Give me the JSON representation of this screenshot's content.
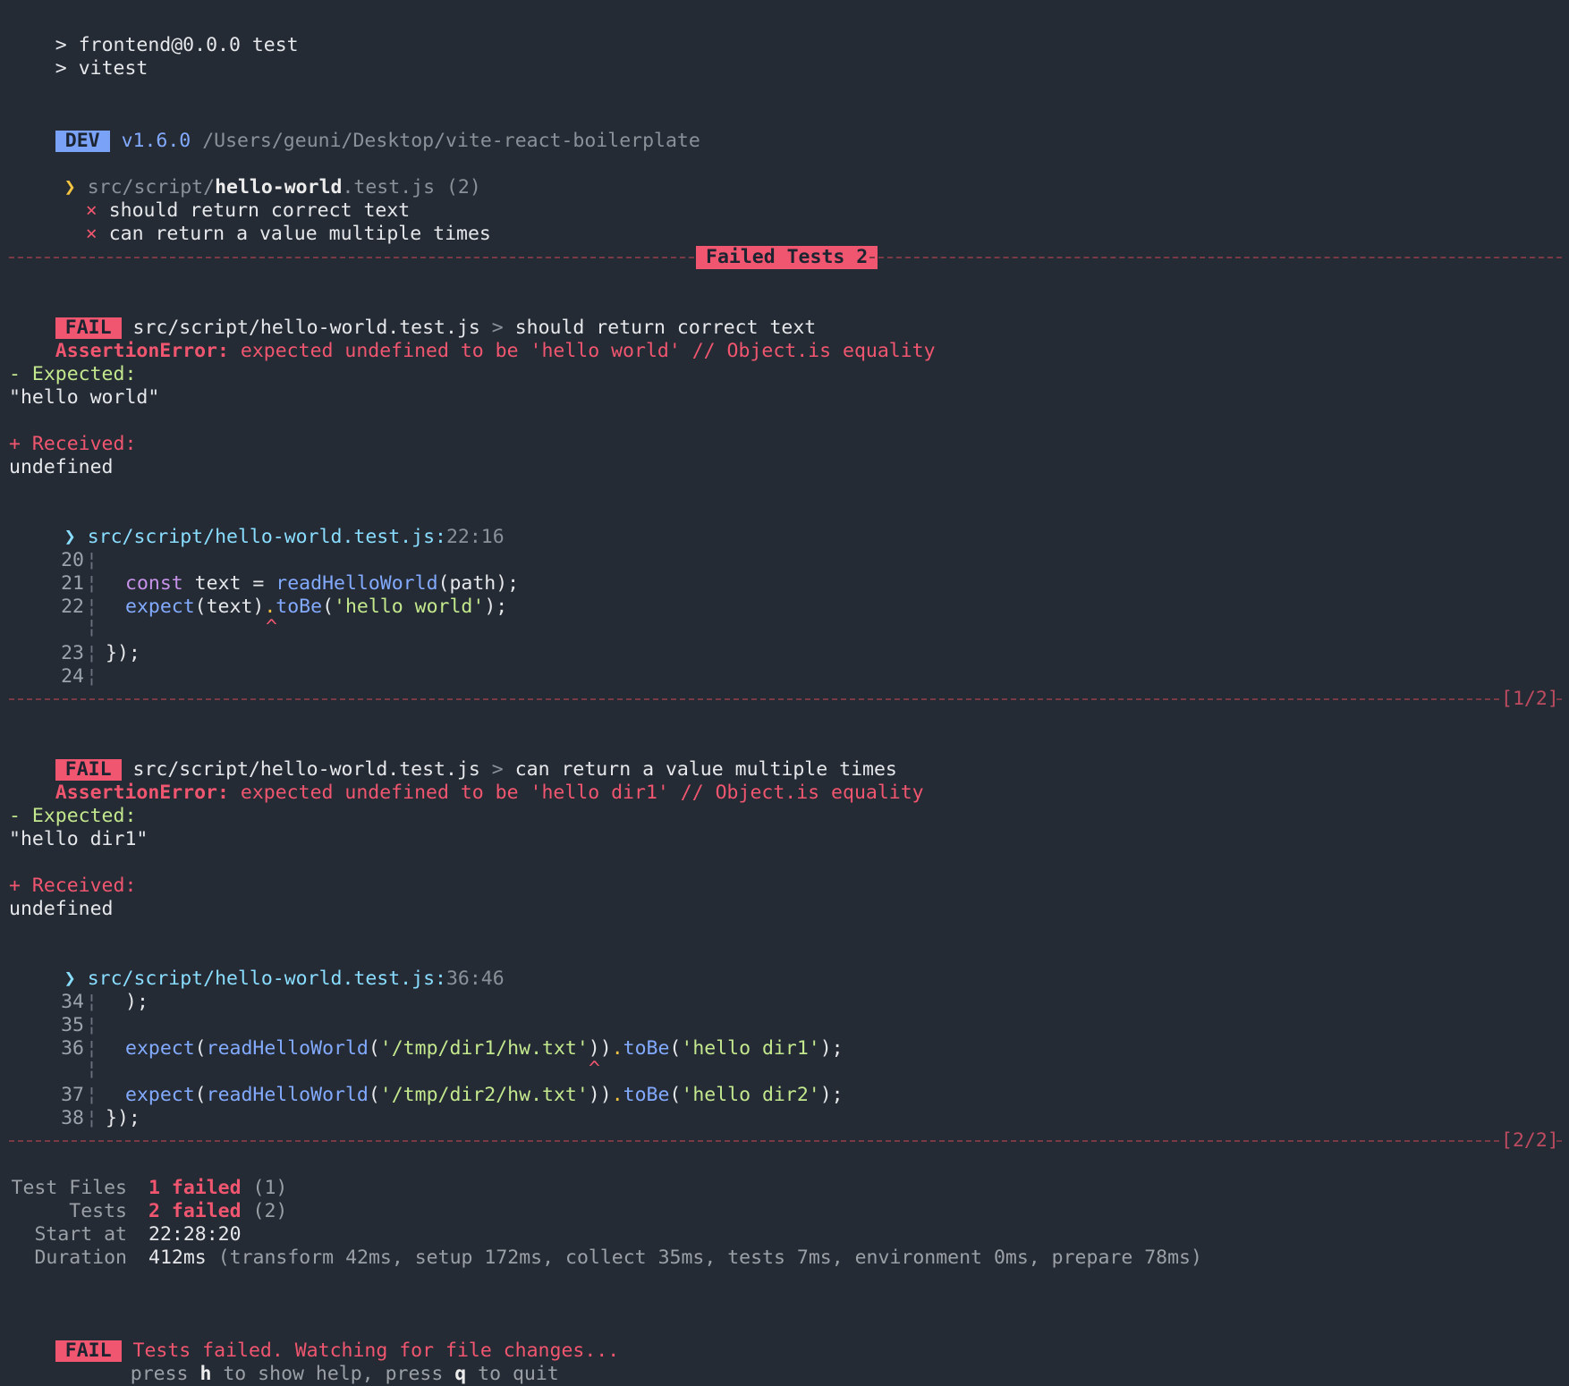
{
  "header": {
    "line1_prompt": ">",
    "line1_text": "frontend@0.0.0 test",
    "line2_prompt": ">",
    "line2_text": "vitest"
  },
  "dev_line": {
    "badge": "DEV",
    "version": "v1.6.0",
    "path": "/Users/geuni/Desktop/vite-react-boilerplate"
  },
  "file_summary": {
    "chevron": "❯",
    "dir": "src/script/",
    "name": "hello-world",
    "ext": ".test.js",
    "count": "(2)",
    "tests": [
      {
        "mark": "×",
        "name": "should return correct text"
      },
      {
        "mark": "×",
        "name": "can return a value multiple times"
      }
    ]
  },
  "failed_banner": "Failed Tests 2",
  "failures": [
    {
      "badge": "FAIL",
      "file": "src/script/hello-world.test.js",
      "arrow": ">",
      "test": "should return correct text",
      "error_label": "AssertionError:",
      "error_msg": "expected undefined to be 'hello world' // Object.is equality",
      "expected_label": "- Expected:",
      "expected_value": "\"hello world\"",
      "received_label": "+ Received:",
      "received_value": "undefined",
      "loc_chevron": "❯",
      "loc_file": "src/script/hello-world.test.js:",
      "loc_pos": "22:16",
      "code": {
        "l20": "20",
        "l21": "21",
        "l22": "22",
        "l23": "23",
        "l24": "24",
        "gutter": "¦",
        "c21_kw": "const",
        "c21_a": " text = ",
        "c21_fn": "readHelloWorld",
        "c21_b": "(path);",
        "c22_fn": "expect",
        "c22_a": "(text)",
        "c22_dot": ".",
        "c22_fn2": "toBe",
        "c22_b": "(",
        "c22_str": "'hello world'",
        "c22_c": ");",
        "caret": "^",
        "c23": "});"
      },
      "counter": "[1/2]"
    },
    {
      "badge": "FAIL",
      "file": "src/script/hello-world.test.js",
      "arrow": ">",
      "test": "can return a value multiple times",
      "error_label": "AssertionError:",
      "error_msg": "expected undefined to be 'hello dir1' // Object.is equality",
      "expected_label": "- Expected:",
      "expected_value": "\"hello dir1\"",
      "received_label": "+ Received:",
      "received_value": "undefined",
      "loc_chevron": "❯",
      "loc_file": "src/script/hello-world.test.js:",
      "loc_pos": "36:46",
      "code": {
        "l34": "34",
        "l35": "35",
        "l36": "36",
        "l37": "37",
        "l38": "38",
        "gutter": "¦",
        "c34": ");",
        "c36_fn": "expect",
        "c36_a": "(",
        "c36_fn2": "readHelloWorld",
        "c36_b": "(",
        "c36_str": "'/tmp/dir1/hw.txt'",
        "c36_c": "))",
        "c36_dot": ".",
        "c36_fn3": "toBe",
        "c36_d": "(",
        "c36_str2": "'hello dir1'",
        "c36_e": ");",
        "caret": "^",
        "c37_fn": "expect",
        "c37_a": "(",
        "c37_fn2": "readHelloWorld",
        "c37_b": "(",
        "c37_str": "'/tmp/dir2/hw.txt'",
        "c37_c": "))",
        "c37_dot": ".",
        "c37_fn3": "toBe",
        "c37_d": "(",
        "c37_str2": "'hello dir2'",
        "c37_e": ");",
        "c38": "});"
      },
      "counter": "[2/2]"
    }
  ],
  "summary": {
    "test_files_label": "Test Files",
    "test_files_value": "1 failed",
    "test_files_count": "(1)",
    "tests_label": "Tests",
    "tests_value": "2 failed",
    "tests_count": "(2)",
    "start_label": "Start at",
    "start_value": "22:28:20",
    "duration_label": "Duration",
    "duration_value": "412ms",
    "duration_detail": "(transform 42ms, setup 172ms, collect 35ms, tests 7ms, environment 0ms, prepare 78ms)"
  },
  "footer": {
    "badge": "FAIL",
    "message": "Tests failed. Watching for file changes...",
    "hint_press1": "press ",
    "hint_key1": "h",
    "hint_mid": " to show help, press ",
    "hint_key2": "q",
    "hint_end": " to quit"
  },
  "colors": {
    "background": "#252b34",
    "fail_red": "#f0566f",
    "dev_blue": "#7aa2f7",
    "expected_green": "#c3e88d",
    "path_cyan": "#89ddff"
  }
}
